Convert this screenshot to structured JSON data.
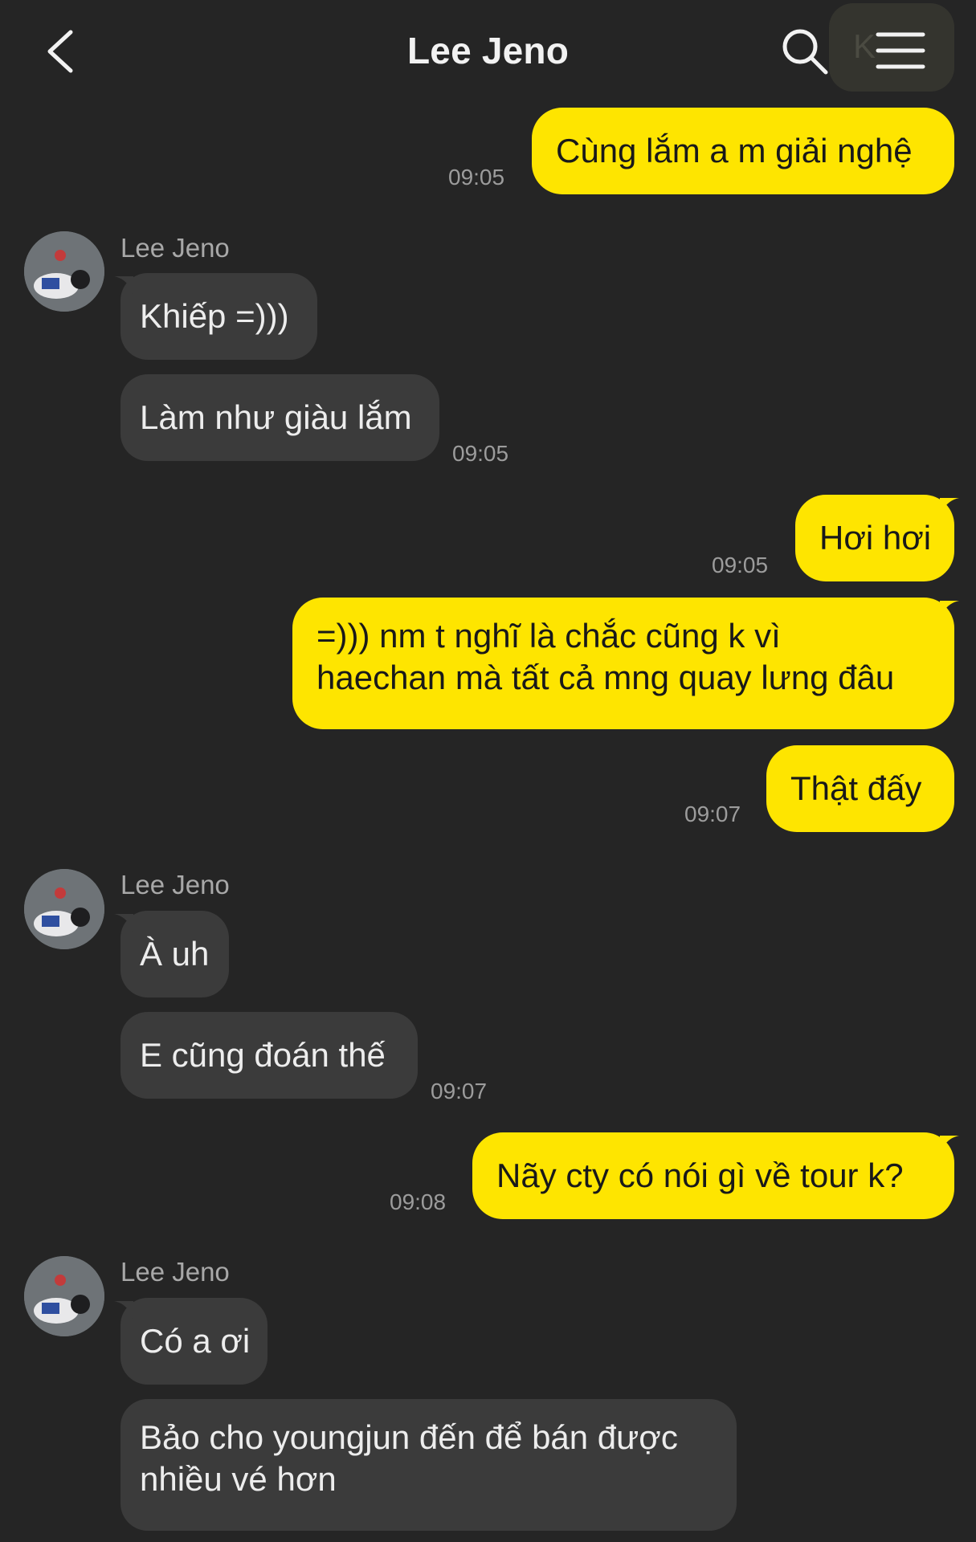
{
  "header": {
    "title": "Lee Jeno",
    "back_icon": "chevron-left-icon",
    "search_icon": "search-icon",
    "menu_icon": "hamburger-menu-icon",
    "partial_overlay_text": "K"
  },
  "colors": {
    "background": "#252525",
    "my_bubble": "#fee500",
    "their_bubble": "#3b3b3b",
    "timestamp": "#9c9c9c"
  },
  "messages": [
    {
      "from": "me",
      "lines": [
        "Cùng lắm a m giải nghệ"
      ],
      "time": "09:05"
    },
    {
      "from": "them",
      "sender": "Lee Jeno",
      "lines": [
        "Khiếp =)))"
      ]
    },
    {
      "from": "them",
      "lines": [
        "Làm như giàu lắm"
      ],
      "time": "09:05"
    },
    {
      "from": "me",
      "lines": [
        "Hơi hơi"
      ],
      "time": "09:05"
    },
    {
      "from": "me",
      "lines": [
        "=))) nm t nghĩ là chắc cũng k vì",
        "haechan mà tất cả mng quay lưng đâu"
      ]
    },
    {
      "from": "me",
      "lines": [
        "Thật đấy"
      ],
      "time": "09:07"
    },
    {
      "from": "them",
      "sender": "Lee Jeno",
      "lines": [
        "À uh"
      ]
    },
    {
      "from": "them",
      "lines": [
        "E cũng đoán thế"
      ],
      "time": "09:07"
    },
    {
      "from": "me",
      "lines": [
        "Nãy cty có nói gì về tour k?"
      ],
      "time": "09:08"
    },
    {
      "from": "them",
      "sender": "Lee Jeno",
      "lines": [
        "Có a ơi"
      ]
    },
    {
      "from": "them",
      "lines": [
        "Bảo cho youngjun đến để bán được",
        "nhiều vé hơn"
      ]
    }
  ]
}
